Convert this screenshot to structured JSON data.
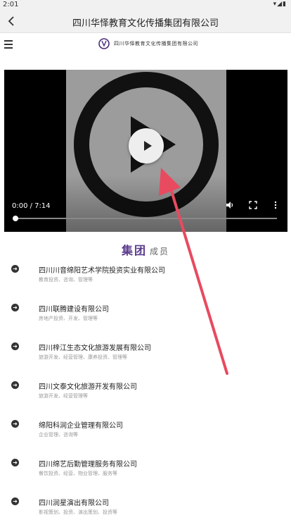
{
  "status": {
    "time": "2:01",
    "icons": "▾◢▮"
  },
  "app_bar": {
    "title": "四川华怿教育文化传播集团有限公司",
    "back_icon": "chevron-left-icon"
  },
  "site_header": {
    "logo_text": "四川华怿教育文化传播集团有限公司",
    "menu_icon": "hamburger-menu-icon"
  },
  "video": {
    "time": "0:00 / 7:14",
    "progress": 0
  },
  "section": {
    "title_strong": "集团",
    "title_light": "成员"
  },
  "members": [
    {
      "name": "四川川音绵阳艺术学院投资实业有限公司",
      "desc": "教育投资、咨询、管理等"
    },
    {
      "name": "四川联腾建设有限公司",
      "desc": "房地产投资、开发、管理等"
    },
    {
      "name": "四川梓江生态文化旅游发展有限公司",
      "desc": "旅游开发、经营管理、康养投资、管理等"
    },
    {
      "name": "四川文泰文化旅游开发有限公司",
      "desc": "旅游开发、经营管理等"
    },
    {
      "name": "绵阳科润企业管理有限公司",
      "desc": "企业管理、咨询等"
    },
    {
      "name": "四川绵艺后勤管理服务有限公司",
      "desc": "餐饮投资、经营、物业管理、服务等"
    },
    {
      "name": "四川润星演出有限公司",
      "desc": "影视策划、投资、演出策划、投资等"
    }
  ]
}
